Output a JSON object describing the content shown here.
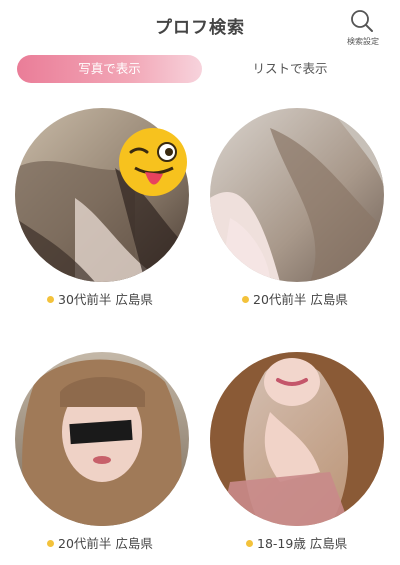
{
  "header": {
    "title": "プロフ検索",
    "search_label": "検索設定"
  },
  "tabs": {
    "photo_view": "写真で表示",
    "list_view": "リストで表示"
  },
  "profiles": [
    {
      "info": "30代前半 広島県",
      "status_color": "#f3c23b"
    },
    {
      "info": "20代前半 広島県",
      "status_color": "#f3c23b"
    },
    {
      "info": "20代前半 広島県",
      "status_color": "#f3c23b"
    },
    {
      "info": "18-19歳 広島県",
      "status_color": "#f3c23b"
    }
  ]
}
